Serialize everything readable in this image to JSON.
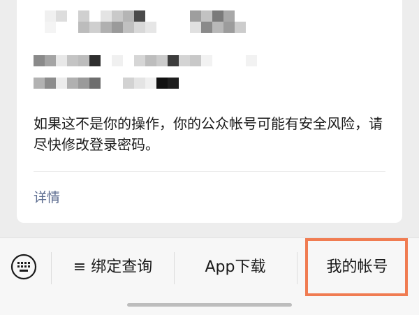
{
  "message": {
    "warning_text": "如果这不是你的操作，你的公众帐号可能有安全风险，请尽快修改登录密码。",
    "details_link": "详情"
  },
  "bottom_menu": {
    "keyboard_icon": "keyboard-icon",
    "items": [
      {
        "label": "≡ 绑定查询"
      },
      {
        "label": "App下载"
      },
      {
        "label": "我的帐号"
      }
    ]
  },
  "colors": {
    "background": "#ededed",
    "card": "#ffffff",
    "text": "#1a1a1a",
    "link": "#5b6b8f",
    "highlight_border": "#f07c52",
    "bottom_bar": "#f7f7f7"
  }
}
